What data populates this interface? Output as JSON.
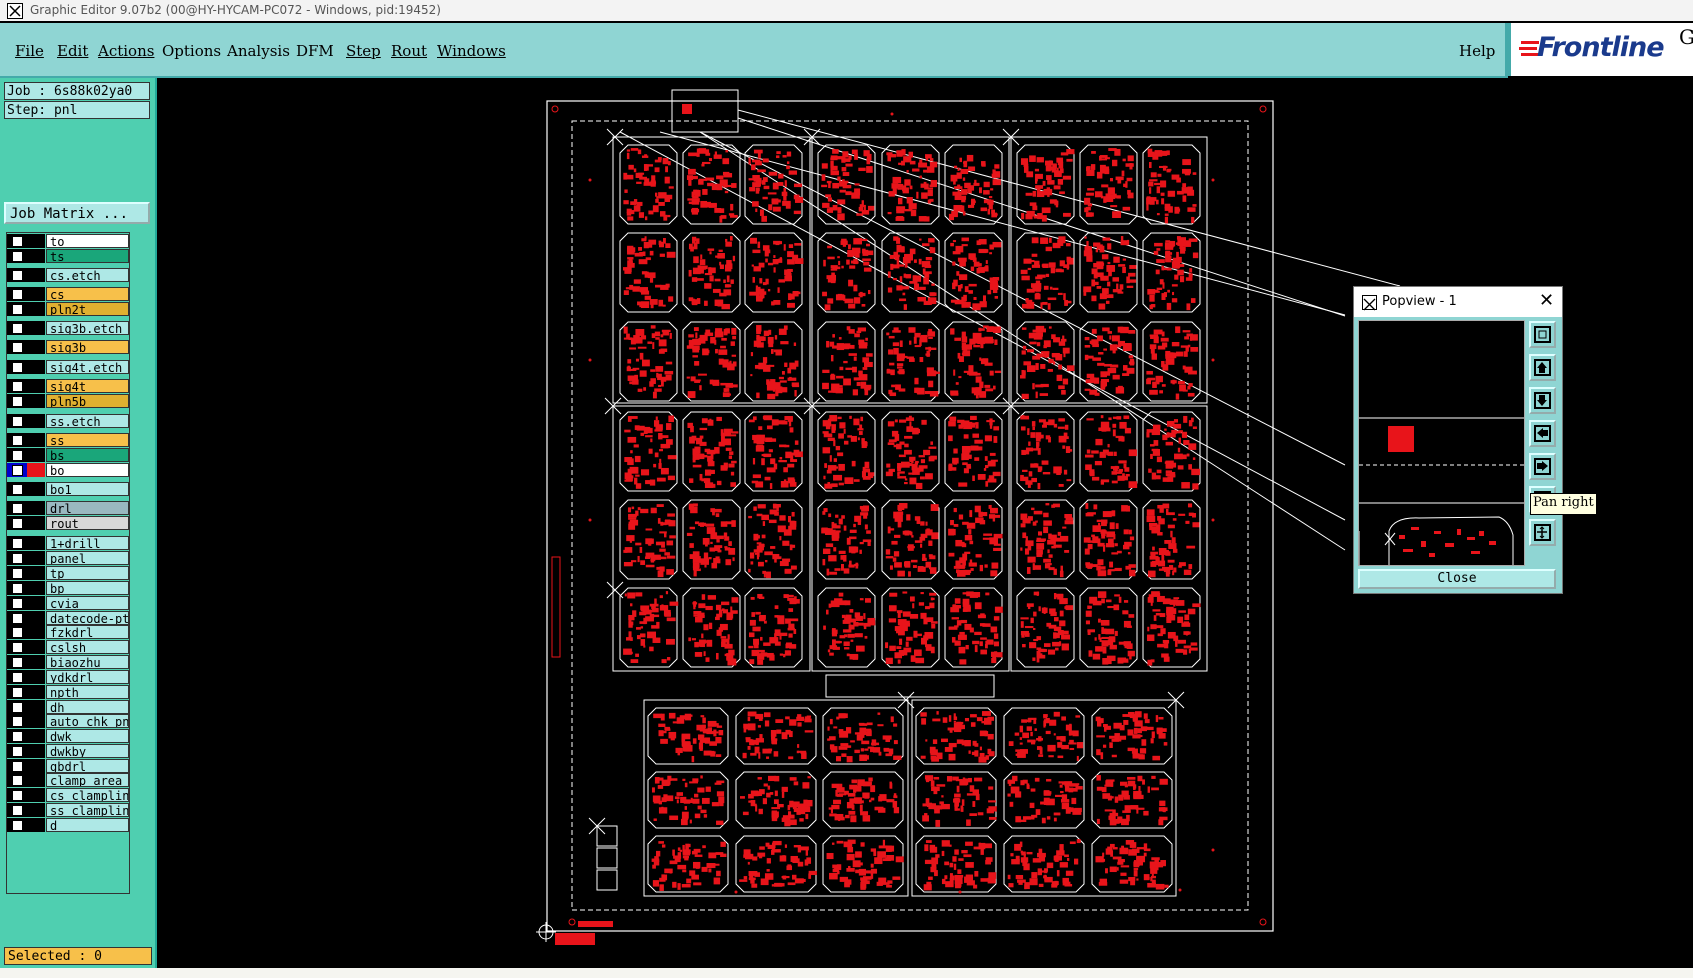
{
  "titlebar": {
    "title": "Graphic Editor 9.07b2 (00@HY-HYCAM-PC072 - Windows, pid:19452)"
  },
  "menu": {
    "file": "File",
    "edit": "Edit",
    "actions": "Actions",
    "options": "Options",
    "analysis": "Analysis",
    "dfm": "DFM",
    "step": "Step",
    "rout": "Rout",
    "windows": "Windows",
    "help": "Help"
  },
  "logo": {
    "text": "Frontline",
    "corner": "G"
  },
  "job": {
    "job_label": "Job : 6s88k02ya0",
    "step_label": "Step: pnl",
    "matrix_button": "Job Matrix ..."
  },
  "layers": [
    {
      "name": "to",
      "color": "#ffffff"
    },
    {
      "name": "ts",
      "color": "#1aa67a"
    },
    {
      "name": "cs.etch",
      "color": "#aee8e6"
    },
    {
      "name": "cs",
      "color": "#f7c04a"
    },
    {
      "name": "pln2t",
      "color": "#e0b030"
    },
    {
      "name": "sig3b.etch",
      "color": "#aee8e6"
    },
    {
      "name": "sig3b",
      "color": "#f7c04a"
    },
    {
      "name": "sig4t.etch",
      "color": "#aee8e6"
    },
    {
      "name": "sig4t",
      "color": "#f7c04a"
    },
    {
      "name": "pln5b",
      "color": "#e0b030"
    },
    {
      "name": "ss.etch",
      "color": "#aee8e6"
    },
    {
      "name": "ss",
      "color": "#f7c04a"
    },
    {
      "name": "bs",
      "color": "#1aa67a"
    },
    {
      "name": "bo",
      "color": "#ffffff",
      "active": true
    },
    {
      "name": "bo1",
      "color": "#aee8e6"
    },
    {
      "name": "drl",
      "color": "#9ab8c0"
    },
    {
      "name": "rout",
      "color": "#d8d8d8"
    },
    {
      "name": "1+drill",
      "color": "#aee8e6"
    },
    {
      "name": "panel",
      "color": "#aee8e6"
    },
    {
      "name": "tp",
      "color": "#aee8e6"
    },
    {
      "name": "bp",
      "color": "#aee8e6"
    },
    {
      "name": "cvia",
      "color": "#aee8e6"
    },
    {
      "name": "datecode-pte",
      "color": "#aee8e6"
    },
    {
      "name": "fzkdrl",
      "color": "#aee8e6"
    },
    {
      "name": "cslsh",
      "color": "#aee8e6"
    },
    {
      "name": "biaozhu",
      "color": "#aee8e6"
    },
    {
      "name": "ydkdrl",
      "color": "#aee8e6"
    },
    {
      "name": "npth",
      "color": "#aee8e6"
    },
    {
      "name": "dh",
      "color": "#aee8e6"
    },
    {
      "name": "auto_chk_pnl",
      "color": "#aee8e6"
    },
    {
      "name": "dwk",
      "color": "#aee8e6"
    },
    {
      "name": "dwkby",
      "color": "#aee8e6"
    },
    {
      "name": "gbdrl",
      "color": "#aee8e6"
    },
    {
      "name": "clamp_area",
      "color": "#aee8e6"
    },
    {
      "name": "cs_clampline",
      "color": "#aee8e6"
    },
    {
      "name": "ss_clampline",
      "color": "#aee8e6"
    },
    {
      "name": "d",
      "color": "#aee8e6"
    }
  ],
  "status": {
    "selected": "Selected : 0"
  },
  "popview": {
    "title": "Popview - 1",
    "close": "Close",
    "tooltip": "Pan right"
  },
  "colors": {
    "board_copper": "#e8141a",
    "outline": "#ffffff",
    "panel_bg": "#4fcfb0",
    "menubar": "#8fd5d3"
  }
}
